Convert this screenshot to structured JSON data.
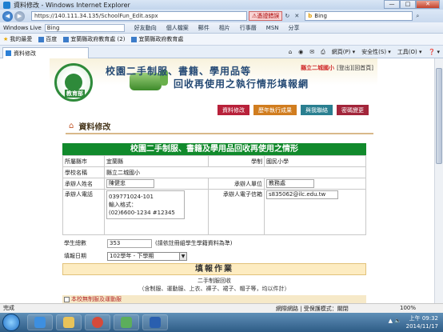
{
  "window": {
    "title": "資料修改 - Windows Internet Explorer",
    "minimize": "—",
    "maximize": "□",
    "close": "✕"
  },
  "address_bar": {
    "url": "https://140.111.34.135/SchoolFun_Edit.aspx",
    "cert_warning": "憑證錯誤",
    "search_engine": "Bing",
    "search_value": "Bing"
  },
  "live_bar": {
    "brand": "Windows Live",
    "search_value": "Bing",
    "links": [
      "好友動向",
      "個人檔案",
      "郵件",
      "相片",
      "行事曆",
      "MSN",
      "分享"
    ]
  },
  "favorites_bar": {
    "label": "我的最愛",
    "items": [
      "百度",
      "宜蘭縣政府教育處 (2)",
      "宜蘭縣政府教育處"
    ]
  },
  "tab": {
    "label": "資料修改"
  },
  "command_bar": {
    "items": [
      "網頁(P) ▾",
      "安全性(S) ▾",
      "工具(O) ▾",
      "❓ ▾"
    ]
  },
  "banner": {
    "seal_label": "教育部",
    "title_line1": "校園二手制服、書籍、學用品等",
    "title_line2": "回收再使用之執行情形填報網",
    "school_name": "縣立二城國小",
    "logout": "[登出]",
    "home": "[回首頁]"
  },
  "menu": {
    "items": [
      "資料修改",
      "歷年執行成果",
      "與我聯絡",
      "密碼變更"
    ]
  },
  "section": {
    "title": "資料修改"
  },
  "form": {
    "title": "校園二手制服、書籍及學用品回收再使用之情形",
    "county_label": "所屬縣市",
    "county_value": "宜蘭縣",
    "level_label": "學制",
    "level_value": "國民小學",
    "school_label": "學校名稱",
    "school_value": "縣立二城國小",
    "contact_label": "承辦人姓名",
    "contact_value": "陳健忠",
    "unit_label": "承辦人單位",
    "unit_value": "教務處",
    "phone_label": "承辦人電話",
    "phone_value": "039771024-101",
    "phone_hint_label": "輸入格式：",
    "phone_hint": "(02)6600-1234 #12345",
    "email_label": "承辦人電子信箱",
    "email_value": "s835062@ilc.edu.tw",
    "students_label": "學生總數",
    "students_value": "353",
    "students_note": "(請依註冊組學生學籍資料為準)",
    "date_label": "填報日期",
    "date_value": "102學年 - 下學期"
  },
  "task": {
    "header": "填報作業",
    "subheader": "二手制服回收",
    "subnote": "（含制服、運動服、上衣、褲子、裙子、帽子等，均以件計）",
    "checkbox_label": "本校無制服及運動服"
  },
  "status_bar": {
    "left": "完成",
    "zone": "網際網路 | 受保護模式：關閉",
    "zoom": "100%"
  },
  "taskbar": {
    "time": "上午 09:32",
    "date": "2014/11/17",
    "tray": "▲ 🔈"
  }
}
